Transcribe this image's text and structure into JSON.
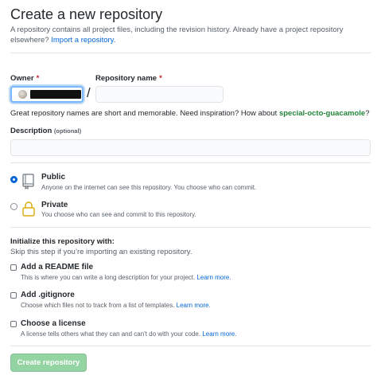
{
  "header": {
    "title": "Create a new repository",
    "subtitle": "A repository contains all project files, including the revision history. Already have a project repository elsewhere?",
    "import_link": "Import a repository."
  },
  "owner": {
    "label": "Owner",
    "required_mark": "*"
  },
  "repo_name": {
    "label": "Repository name",
    "required_mark": "*",
    "value": "",
    "placeholder": ""
  },
  "hint": {
    "text": "Great repository names are short and memorable. Need inspiration? How about",
    "suggestion": "special-octo-guacamole",
    "end": "?"
  },
  "description": {
    "label": "Description",
    "optional": "(optional)",
    "value": ""
  },
  "visibility": {
    "selected": "public",
    "public": {
      "title": "Public",
      "desc": "Anyone on the internet can see this repository. You choose who can commit.",
      "icon": "repo-icon"
    },
    "private": {
      "title": "Private",
      "desc": "You choose who can see and commit to this repository.",
      "icon": "lock-icon"
    }
  },
  "init": {
    "title": "Initialize this repository with:",
    "subtitle": "Skip this step if you’re importing an existing repository.",
    "readme": {
      "title": "Add a README file",
      "desc": "This is where you can write a long description for your project.",
      "link": "Learn more."
    },
    "gitignore": {
      "title": "Add .gitignore",
      "desc": "Choose which files not to track from a list of templates.",
      "link": "Learn more."
    },
    "license": {
      "title": "Choose a license",
      "desc": "A license tells others what they can and can't do with your code.",
      "link": "Learn more."
    }
  },
  "submit": {
    "label": "Create repository"
  },
  "colors": {
    "link": "#0366d6",
    "suggestion": "#22863a",
    "required": "#cb2431",
    "button_disabled": "#94d3a2",
    "radio_selected": "#0366d6"
  }
}
